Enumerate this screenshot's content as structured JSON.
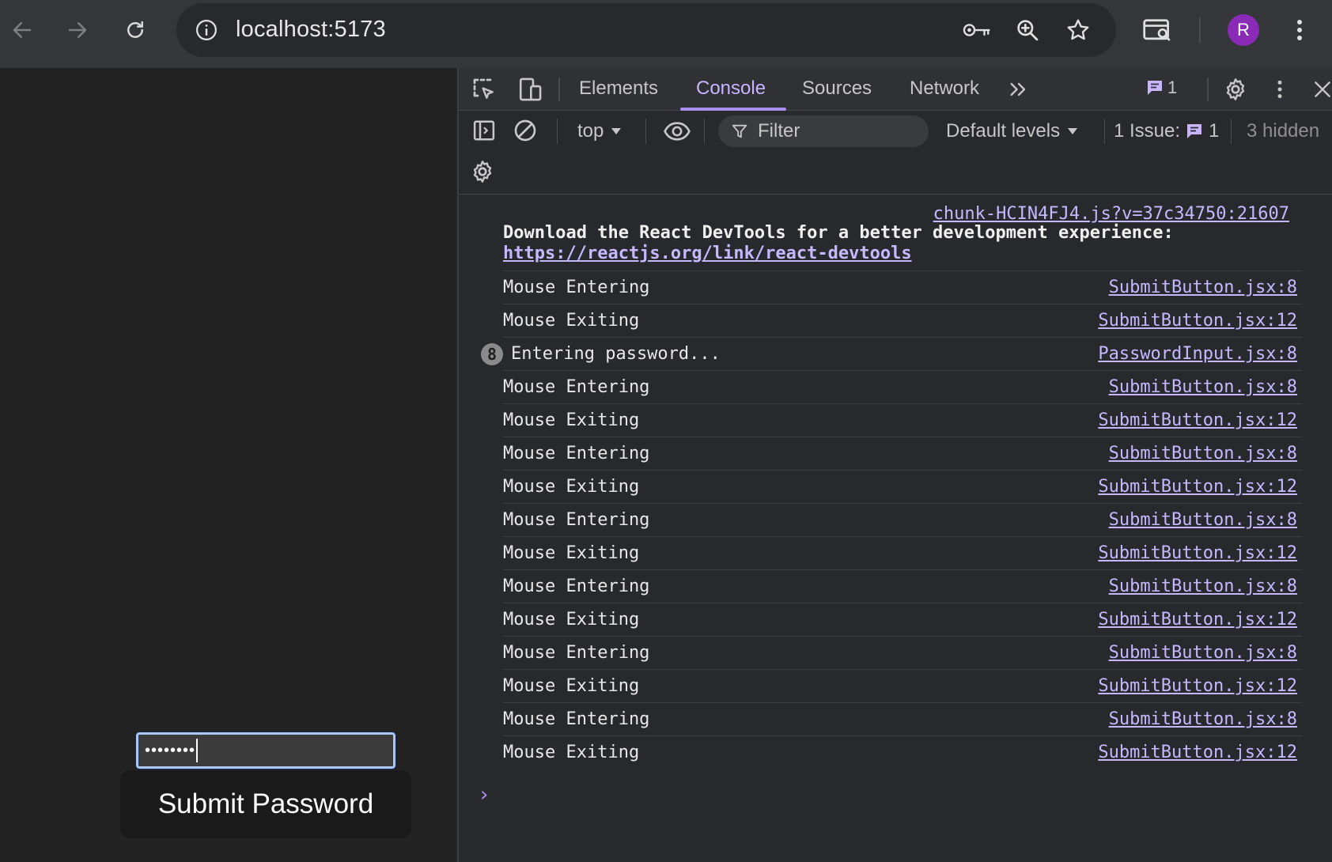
{
  "browser": {
    "url": "localhost:5173",
    "profile_initial": "R"
  },
  "page": {
    "password_value": "••••••••",
    "submit_label": "Submit Password"
  },
  "devtools": {
    "tabs": [
      "Elements",
      "Console",
      "Sources",
      "Network"
    ],
    "active_tab": "Console",
    "issues_count": "1",
    "context": "top",
    "filter_placeholder": "Filter",
    "levels": "Default levels",
    "issues_label": "1 Issue:",
    "issues_inline_count": "1",
    "hidden_label": "3 hidden"
  },
  "console": {
    "devtools_source": "chunk-HCIN4FJ4.js?v=37c34750:21607",
    "devtools_message": "Download the React DevTools for a better development experience:",
    "devtools_link": "https://reactjs.org/link/react-devtools",
    "logs": [
      {
        "text": "Mouse Entering",
        "source": "SubmitButton.jsx:8"
      },
      {
        "text": "Mouse Exiting",
        "source": "SubmitButton.jsx:12"
      },
      {
        "text": "Entering password...",
        "source": "PasswordInput.jsx:8",
        "repeat": "8"
      },
      {
        "text": "Mouse Entering",
        "source": "SubmitButton.jsx:8"
      },
      {
        "text": "Mouse Exiting",
        "source": "SubmitButton.jsx:12"
      },
      {
        "text": "Mouse Entering",
        "source": "SubmitButton.jsx:8"
      },
      {
        "text": "Mouse Exiting",
        "source": "SubmitButton.jsx:12"
      },
      {
        "text": "Mouse Entering",
        "source": "SubmitButton.jsx:8"
      },
      {
        "text": "Mouse Exiting",
        "source": "SubmitButton.jsx:12"
      },
      {
        "text": "Mouse Entering",
        "source": "SubmitButton.jsx:8"
      },
      {
        "text": "Mouse Exiting",
        "source": "SubmitButton.jsx:12"
      },
      {
        "text": "Mouse Entering",
        "source": "SubmitButton.jsx:8"
      },
      {
        "text": "Mouse Exiting",
        "source": "SubmitButton.jsx:12"
      },
      {
        "text": "Mouse Entering",
        "source": "SubmitButton.jsx:8"
      },
      {
        "text": "Mouse Exiting",
        "source": "SubmitButton.jsx:12"
      }
    ],
    "prompt": "›"
  }
}
